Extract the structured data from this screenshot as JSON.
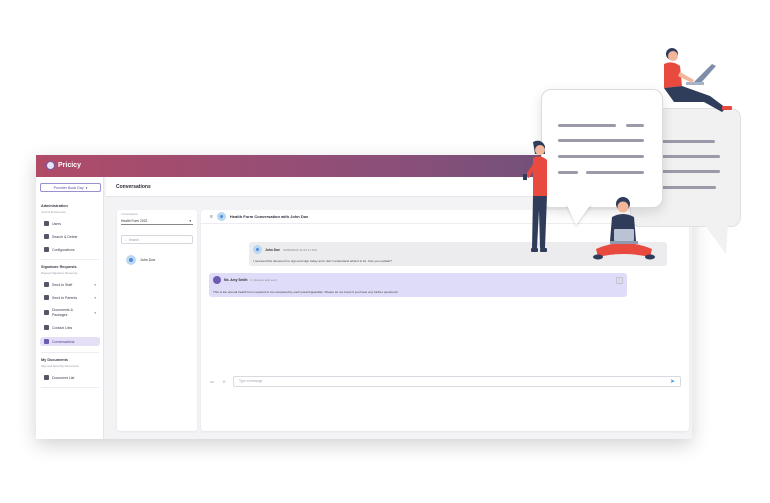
{
  "app": {
    "logo_text": "Pricicy",
    "brand_colors": {
      "gradient_start": "#b04b68",
      "gradient_end": "#5a5477",
      "accent": "#6c5bb0"
    }
  },
  "sidebar": {
    "provider_button": "Provider Book Day",
    "sections": [
      {
        "title": "Administration",
        "subtitle": "Control Preferences"
      },
      {
        "title": "Signature Requests",
        "subtitle": "Request Signature Response"
      },
      {
        "title": "My Documents",
        "subtitle": "Sign and Send My Documents"
      }
    ],
    "items": [
      {
        "label": "Users",
        "icon": "users-icon"
      },
      {
        "label": "Search & Delete",
        "icon": "search-delete-icon"
      },
      {
        "label": "Configurations",
        "icon": "gear-icon"
      },
      {
        "label": "Send to Staff",
        "icon": "send-staff-icon"
      },
      {
        "label": "Send to Parents",
        "icon": "send-parents-icon"
      },
      {
        "label": "Documents & Packages",
        "icon": "documents-icon"
      },
      {
        "label": "Contact Lists",
        "icon": "contacts-icon"
      },
      {
        "label": "Conversations",
        "icon": "chat-icon"
      },
      {
        "label": "Document List",
        "icon": "document-list-icon"
      }
    ]
  },
  "content": {
    "title": "Conversations"
  },
  "list": {
    "select_label": "Conversations",
    "select_value": "Health Form 2022",
    "search_placeholder": "Search",
    "contacts": [
      {
        "name": "John Doe"
      }
    ]
  },
  "chat": {
    "title": "Health Form Conversation with John Doe",
    "messages": [
      {
        "author": "John Doe",
        "time": "02/08/2023 11:04:17 PM",
        "text": "I received this document to sign and sign today and I don't understand what it is for. Can you explain?"
      },
      {
        "author": "Ms. Amy Smith",
        "time": "4 minutes and sent",
        "text": "This is the annual health form required to be completed by each parent/guardian. Please let me know if you have any further questions!"
      }
    ],
    "composer_placeholder": "Type a message"
  }
}
